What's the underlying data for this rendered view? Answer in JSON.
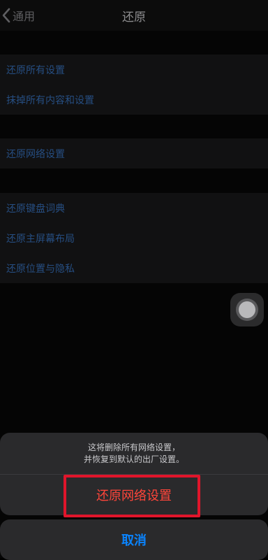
{
  "navbar": {
    "back_label": "通用",
    "title": "还原"
  },
  "groups": [
    {
      "items": [
        "还原所有设置",
        "抹掉所有内容和设置"
      ]
    },
    {
      "items": [
        "还原网络设置"
      ]
    },
    {
      "items": [
        "还原键盘词典",
        "还原主屏幕布局",
        "还原位置与隐私"
      ]
    }
  ],
  "action_sheet": {
    "message_line1": "这将删除所有网络设置，",
    "message_line2": "并恢复到默认的出厂设置。",
    "destructive_label": "还原网络设置",
    "cancel_label": "取消"
  },
  "colors": {
    "link_blue": "#264e82",
    "destructive_red": "#ff453a",
    "cancel_blue": "#0a84ff",
    "highlight_box": "#e0152b"
  }
}
